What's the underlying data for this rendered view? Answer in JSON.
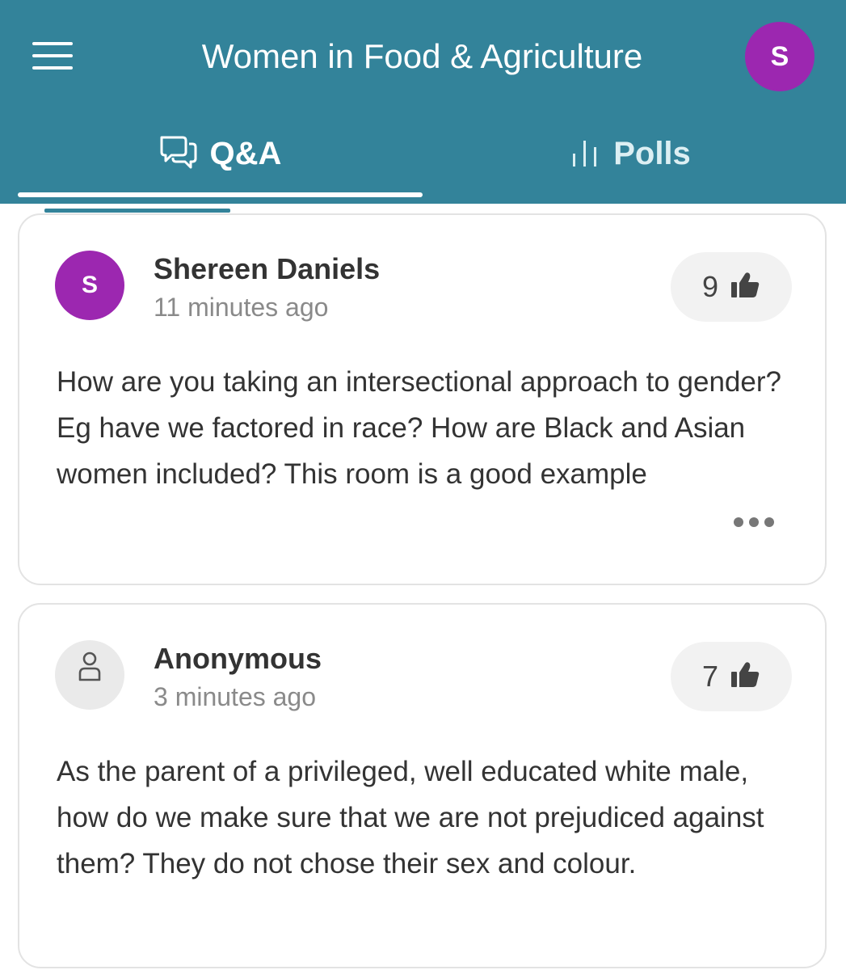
{
  "header": {
    "title": "Women in Food & Agriculture",
    "avatar_initial": "S",
    "avatar_color": "#9c27b0",
    "bar_color": "#33839a"
  },
  "tabs": [
    {
      "label": "Q&A",
      "icon": "speech-bubbles-icon",
      "active": true
    },
    {
      "label": "Polls",
      "icon": "bar-chart-icon",
      "active": false
    }
  ],
  "questions": [
    {
      "author": "Shereen Daniels",
      "avatar_initial": "S",
      "avatar_color": "#9c27b0",
      "time": "11 minutes ago",
      "likes": "9",
      "text": "How are you taking an intersectional approach to gender? Eg have we factored in race? How are Black and Asian women included? This room is a good example"
    },
    {
      "author": "Anonymous",
      "avatar_icon": "user-outline-icon",
      "time": "3 minutes ago",
      "likes": "7",
      "text": "As the parent of a privileged, well educated white male, how do we make sure that we are not prejudiced against them? They do not chose their sex and colour."
    }
  ]
}
